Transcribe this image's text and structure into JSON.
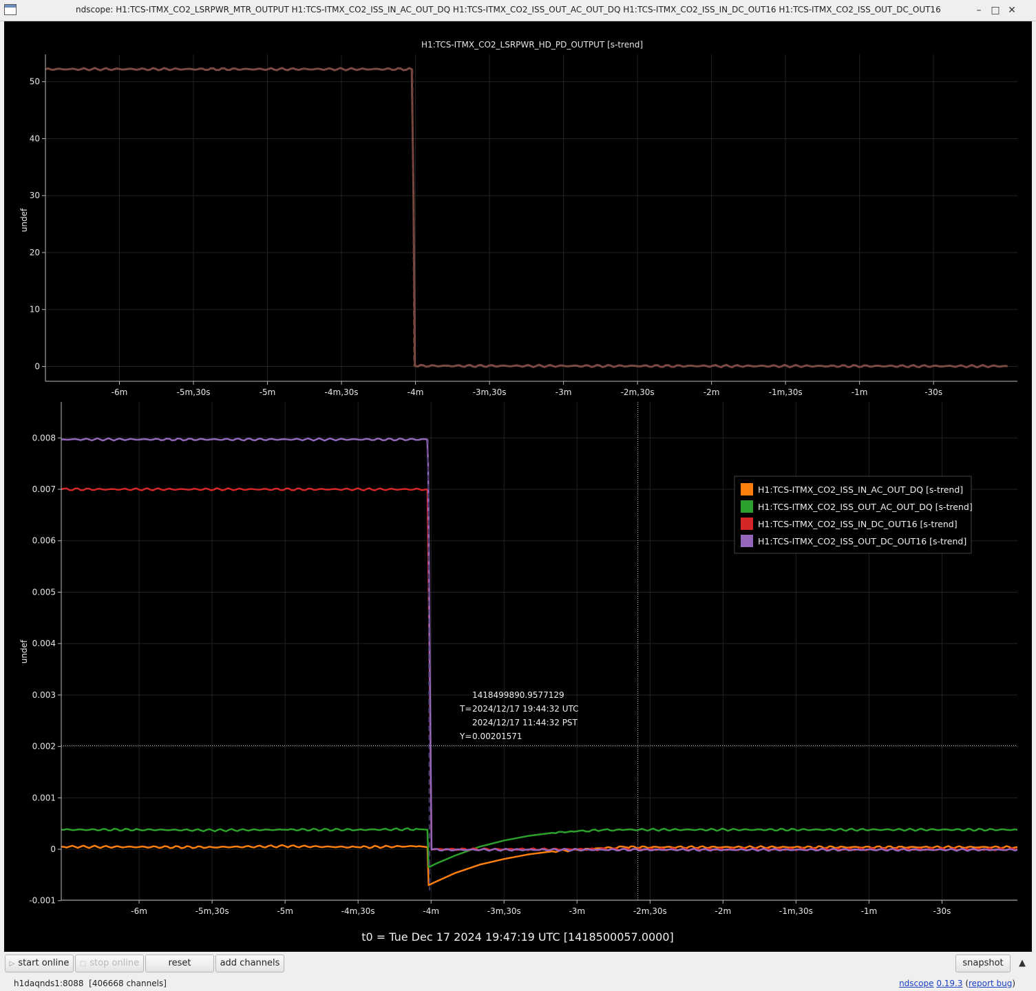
{
  "window": {
    "title": "ndscope: H1:TCS-ITMX_CO2_LSRPWR_MTR_OUTPUT H1:TCS-ITMX_CO2_ISS_IN_AC_OUT_DQ H1:TCS-ITMX_CO2_ISS_OUT_AC_OUT_DQ H1:TCS-ITMX_CO2_ISS_IN_DC_OUT16 H1:TCS-ITMX_CO2_ISS_OUT_DC_OUT16",
    "minimize_glyph": "–",
    "maximize_glyph": "□",
    "close_glyph": "✕"
  },
  "chart_data": [
    {
      "type": "line",
      "title": "H1:TCS-ITMX_CO2_LSRPWR_HD_PD_OUTPUT [s-trend]",
      "ylabel": "undef",
      "xlabel": "",
      "xlim": [
        -390,
        4
      ],
      "ylim": [
        -2.6,
        54.8
      ],
      "x_ticks": [
        {
          "v": -360,
          "label": "-6m"
        },
        {
          "v": -330,
          "label": "-5m,30s"
        },
        {
          "v": -300,
          "label": "-5m"
        },
        {
          "v": -270,
          "label": "-4m,30s"
        },
        {
          "v": -240,
          "label": "-4m"
        },
        {
          "v": -210,
          "label": "-3m,30s"
        },
        {
          "v": -180,
          "label": "-3m"
        },
        {
          "v": -150,
          "label": "-2m,30s"
        },
        {
          "v": -120,
          "label": "-2m"
        },
        {
          "v": -90,
          "label": "-1m,30s"
        },
        {
          "v": -60,
          "label": "-1m"
        },
        {
          "v": -30,
          "label": "-30s"
        }
      ],
      "y_ticks": [
        {
          "v": 0,
          "label": "0"
        },
        {
          "v": 10,
          "label": "10"
        },
        {
          "v": 20,
          "label": "20"
        },
        {
          "v": 30,
          "label": "30"
        },
        {
          "v": 40,
          "label": "40"
        },
        {
          "v": 50,
          "label": "50"
        }
      ],
      "grid": true,
      "series": [
        {
          "color": "#7a4a42",
          "width": 3,
          "x": [
            -390,
            -241.5,
            -240.8,
            -240.2,
            0
          ],
          "y": [
            52.2,
            52.2,
            30,
            0.1,
            0.05
          ]
        },
        {
          "color": "#6f4038",
          "width": 2,
          "dash": "8,5",
          "x": [
            -241.2,
            -240.6
          ],
          "y": [
            52.2,
            0.1
          ]
        }
      ]
    },
    {
      "type": "line",
      "title": "",
      "ylabel": "undef",
      "xlabel": "",
      "xlim": [
        -392,
        1
      ],
      "ylim": [
        -0.00099,
        0.0087
      ],
      "x_ticks": [
        {
          "v": -360,
          "label": "-6m"
        },
        {
          "v": -330,
          "label": "-5m,30s"
        },
        {
          "v": -300,
          "label": "-5m"
        },
        {
          "v": -270,
          "label": "-4m,30s"
        },
        {
          "v": -240,
          "label": "-4m"
        },
        {
          "v": -210,
          "label": "-3m,30s"
        },
        {
          "v": -180,
          "label": "-3m"
        },
        {
          "v": -150,
          "label": "-2m,30s"
        },
        {
          "v": -120,
          "label": "-2m"
        },
        {
          "v": -90,
          "label": "-1m,30s"
        },
        {
          "v": -60,
          "label": "-1m"
        },
        {
          "v": -30,
          "label": "-30s"
        }
      ],
      "y_ticks": [
        {
          "v": -0.001,
          "label": "-0.001"
        },
        {
          "v": 0,
          "label": "0"
        },
        {
          "v": 0.001,
          "label": "0.001"
        },
        {
          "v": 0.002,
          "label": "0.002"
        },
        {
          "v": 0.003,
          "label": "0.003"
        },
        {
          "v": 0.004,
          "label": "0.004"
        },
        {
          "v": 0.005,
          "label": "0.005"
        },
        {
          "v": 0.006,
          "label": "0.006"
        },
        {
          "v": 0.007,
          "label": "0.007"
        },
        {
          "v": 0.008,
          "label": "0.008"
        }
      ],
      "grid": true,
      "series": [
        {
          "name": "H1:TCS-ITMX_CO2_ISS_IN_AC_OUT_DQ [s-trend]",
          "color": "#ff7f0e",
          "x": [
            -392,
            -330,
            -300,
            -270,
            -245,
            -241.5,
            -241,
            -238,
            -230,
            -220,
            -210,
            -200,
            -190,
            -180,
            -170,
            -160,
            1
          ],
          "y": [
            5e-05,
            4e-05,
            6e-05,
            4e-05,
            6e-05,
            4e-05,
            -0.0007,
            -0.00063,
            -0.00046,
            -0.0003,
            -0.00019,
            -0.0001,
            -4e-05,
            -1e-05,
            2e-05,
            4e-05,
            4e-05
          ]
        },
        {
          "name": "H1:TCS-ITMX_CO2_ISS_OUT_AC_OUT_DQ [s-trend]",
          "color": "#2ca02c",
          "x": [
            -392,
            -360,
            -330,
            -300,
            -270,
            -245,
            -241.5,
            -241,
            -238,
            -230,
            -220,
            -210,
            -200,
            -190,
            -180,
            -170,
            -160,
            1
          ],
          "y": [
            0.00038,
            0.00038,
            0.00037,
            0.00038,
            0.00038,
            0.00039,
            0.00038,
            -0.00035,
            -0.00028,
            -0.00012,
            5e-05,
            0.00017,
            0.00026,
            0.00032,
            0.00035,
            0.00037,
            0.00038,
            0.00038
          ]
        },
        {
          "name": "H1:TCS-ITMX_CO2_ISS_IN_DC_OUT16 [s-trend]",
          "color": "#d62728",
          "x": [
            -392,
            -241.5,
            -240.6,
            -239.8,
            1
          ],
          "y": [
            0.007,
            0.007,
            0.0035,
            0.0,
            0.0
          ]
        },
        {
          "name": "H1:TCS-ITMX_CO2_ISS_OUT_DC_OUT16 [s-trend]",
          "color": "#9467bd",
          "x": [
            -392,
            -241.6,
            -241.2,
            -240.6,
            -239.8,
            1
          ],
          "y": [
            0.00797,
            0.00797,
            0.0075,
            0.004,
            -1e-05,
            -1e-05
          ]
        },
        {
          "color": "#4a3a6a",
          "width": 2,
          "dash": "8,5",
          "x": [
            -241.2,
            -240.6
          ],
          "y": [
            0.00797,
            -0.0008
          ]
        }
      ],
      "legend": {
        "placement": "top-right"
      },
      "crosshair": {
        "x": -155,
        "y": 0.00201571,
        "gps": "1418499890.9577129",
        "t_label": "T=",
        "utc": "2024/12/17 19:44:32 UTC",
        "pst": "2024/12/17 11:44:32 PST",
        "y_label": "Y=",
        "y_value": "0.00201571"
      }
    }
  ],
  "t0": "t0 = Tue Dec 17 2024 19:47:19 UTC [1418500057.0000]",
  "toolbar": {
    "start_online": "start online",
    "stop_online": "stop online",
    "reset": "reset",
    "add_channels": "add channels",
    "snapshot": "snapshot",
    "start_icon": "play-icon",
    "stop_icon": "stop-icon",
    "expand_glyph": "▲"
  },
  "status": {
    "server": "h1daqnds1:8088  [406668 channels]",
    "app_name": "ndscope",
    "version": "0.19.3",
    "report_bug": "report bug",
    "paren_open": "(",
    "paren_close": ")"
  }
}
